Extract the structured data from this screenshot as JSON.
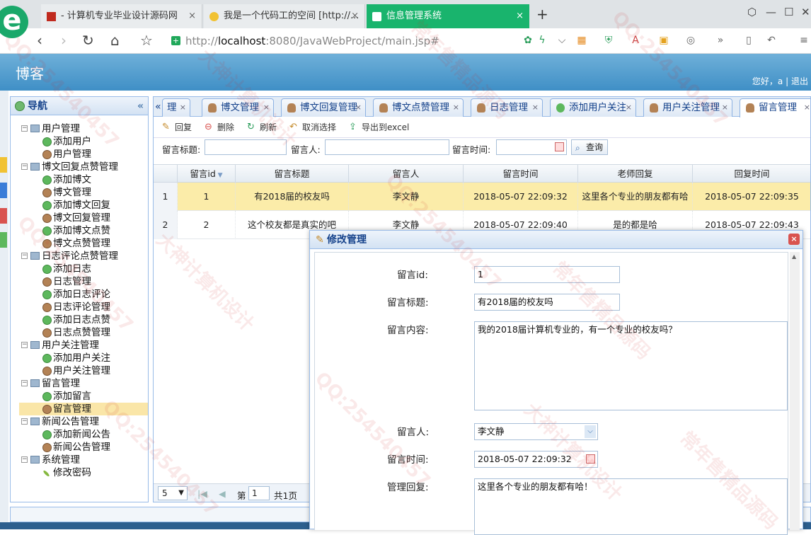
{
  "browser": {
    "tabs": [
      {
        "title": "- 计算机专业毕业设计源码网",
        "close": "×"
      },
      {
        "title": "我是一个代码工的空间 [http://...",
        "close": "×"
      },
      {
        "title": "信息管理系统",
        "close": "×"
      }
    ],
    "new_tab": "+",
    "logo": "e",
    "address_secure": "+",
    "address_prefix": "http://",
    "address_host": "localhost",
    "address_rest": ":8080/JavaWebProject/main.jsp#"
  },
  "header": {
    "title": "博客",
    "greeting": "您好，a",
    "separator": "|",
    "logout": "退出"
  },
  "nav": {
    "title": "导航",
    "groups": [
      {
        "label": "用户管理",
        "items": [
          {
            "label": "添加用户",
            "icon": "add"
          },
          {
            "label": "用户管理",
            "icon": "user"
          }
        ]
      },
      {
        "label": "博文回复点赞管理",
        "items": [
          {
            "label": "添加博文",
            "icon": "add"
          },
          {
            "label": "博文管理",
            "icon": "user"
          },
          {
            "label": "添加博文回复",
            "icon": "add"
          },
          {
            "label": "博文回复管理",
            "icon": "user"
          },
          {
            "label": "添加博文点赞",
            "icon": "add"
          },
          {
            "label": "博文点赞管理",
            "icon": "user"
          }
        ]
      },
      {
        "label": "日志评论点赞管理",
        "items": [
          {
            "label": "添加日志",
            "icon": "add"
          },
          {
            "label": "日志管理",
            "icon": "user"
          },
          {
            "label": "添加日志评论",
            "icon": "add"
          },
          {
            "label": "日志评论管理",
            "icon": "user"
          },
          {
            "label": "添加日志点赞",
            "icon": "add"
          },
          {
            "label": "日志点赞管理",
            "icon": "user"
          }
        ]
      },
      {
        "label": "用户关注管理",
        "items": [
          {
            "label": "添加用户关注",
            "icon": "add"
          },
          {
            "label": "用户关注管理",
            "icon": "user"
          }
        ]
      },
      {
        "label": "留言管理",
        "items": [
          {
            "label": "添加留言",
            "icon": "add"
          },
          {
            "label": "留言管理",
            "icon": "user",
            "selected": true
          }
        ]
      },
      {
        "label": "新闻公告管理",
        "items": [
          {
            "label": "添加新闻公告",
            "icon": "add"
          },
          {
            "label": "新闻公告管理",
            "icon": "user"
          }
        ]
      },
      {
        "label": "系统管理",
        "items": [
          {
            "label": "修改密码",
            "icon": "pen"
          }
        ]
      }
    ]
  },
  "main_tabs": [
    {
      "label": "理",
      "icon": "none"
    },
    {
      "label": "博文管理",
      "icon": "user"
    },
    {
      "label": "博文回复管理",
      "icon": "user"
    },
    {
      "label": "博文点赞管理",
      "icon": "user"
    },
    {
      "label": "日志管理",
      "icon": "user"
    },
    {
      "label": "添加用户关注",
      "icon": "add"
    },
    {
      "label": "用户关注管理",
      "icon": "user"
    },
    {
      "label": "留言管理",
      "icon": "user",
      "active": true
    }
  ],
  "toolbar": {
    "reply": "回复",
    "delete": "删除",
    "refresh": "刷新",
    "cancel_select": "取消选择",
    "export": "导出到excel"
  },
  "search": {
    "title_label": "留言标题:",
    "author_label": "留言人:",
    "time_label": "留言时间:",
    "query": "查询"
  },
  "grid": {
    "columns": [
      "留言id",
      "留言标题",
      "留言人",
      "留言时间",
      "老师回复",
      "回复时间"
    ],
    "rows": [
      {
        "num": "1",
        "id": "1",
        "title": "有2018届的校友吗",
        "author": "李文静",
        "time": "2018-05-07 22:09:32",
        "reply": "这里各个专业的朋友都有哈",
        "reply_time": "2018-05-07 22:09:35"
      },
      {
        "num": "2",
        "id": "2",
        "title": "这个校友都是真实的吧",
        "author": "李文静",
        "time": "2018-05-07 22:09:40",
        "reply": "是的都是哈",
        "reply_time": "2018-05-07 22:09:43"
      }
    ]
  },
  "pager": {
    "page_size": "5",
    "page_prefix": "第",
    "page": "1",
    "total": "共1页"
  },
  "dialog": {
    "title": "修改管理",
    "close": "×",
    "fields": {
      "id_label": "留言id:",
      "id_value": "1",
      "title_label": "留言标题:",
      "title_value": "有2018届的校友吗",
      "content_label": "留言内容:",
      "content_value": "我的2018届计算机专业的，有一个专业的校友吗？",
      "author_label": "留言人:",
      "author_value": "李文静",
      "time_label": "留言时间:",
      "time_value": "2018-05-07 22:09:32",
      "reply_label": "管理回复:",
      "reply_value": "这里各个专业的朋友都有哈！"
    }
  },
  "watermarks": [
    "QQ:254540457",
    "大神计算机设计",
    "常年售精品源码",
    "QQ:254540457",
    "大神计算机设计",
    "QQ:254540457",
    "常年售精品源码",
    "QQ:254540457"
  ]
}
